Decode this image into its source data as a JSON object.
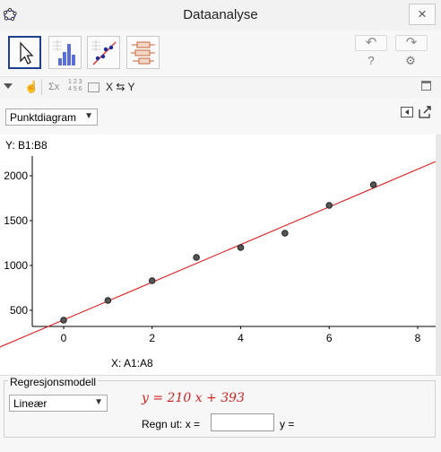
{
  "window": {
    "title": "Dataanalyse",
    "close_glyph": "×"
  },
  "toolbar": {
    "tools": [
      {
        "name": "move-tool",
        "icon": "cursor-arrow-icon"
      },
      {
        "name": "one-variable-tool",
        "icon": "histogram-icon"
      },
      {
        "name": "two-variable-tool",
        "icon": "scatter-regression-icon"
      },
      {
        "name": "multi-variable-tool",
        "icon": "boxplot-icon"
      }
    ],
    "undo_glyph": "↶",
    "redo_glyph": "↷",
    "help_glyph": "?",
    "settings_glyph": "⚙"
  },
  "subbar": {
    "swap_label": "X ⇆ Y",
    "sigma_label": "Σx",
    "numbers_label": "1 2 3\n4 5 6"
  },
  "plot": {
    "type_selected": "Punktdiagram",
    "y_source": "Y:  B1:B8",
    "x_source": "X:  A1:A8"
  },
  "chart_data": {
    "type": "scatter",
    "x": [
      0,
      1,
      2,
      3,
      4,
      5,
      6,
      7
    ],
    "y": [
      390,
      610,
      830,
      1090,
      1200,
      1360,
      1670,
      1900
    ],
    "xlim": [
      -1.4,
      8.4
    ],
    "ylim": [
      370,
      2200
    ],
    "x_ticks": [
      0,
      2,
      4,
      6,
      8
    ],
    "y_ticks": [
      500,
      1000,
      1500,
      2000
    ],
    "grid": false,
    "regression": {
      "slope": 210,
      "intercept": 393,
      "color": "#e01b1b"
    },
    "point_color": "#555555"
  },
  "regression": {
    "heading": "Regresjonsmodell",
    "model_selected": "Lineær",
    "equation": "y = 210 x + 393",
    "calc_label": "Regn ut:  x =",
    "y_label": "y ="
  }
}
